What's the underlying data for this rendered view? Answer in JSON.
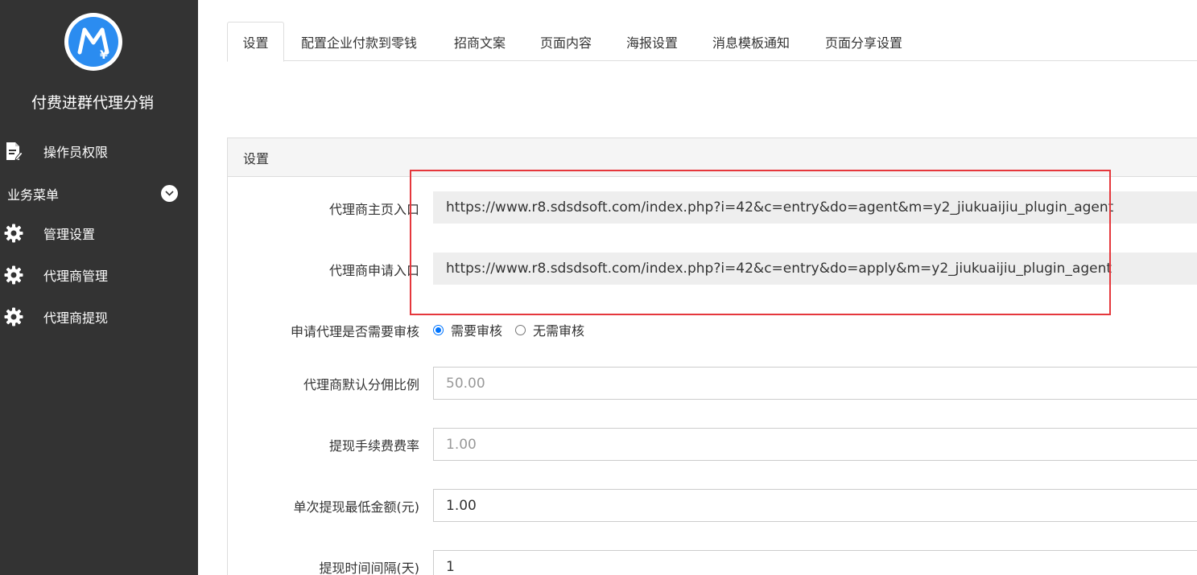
{
  "sidebar": {
    "app_title": "付费进群代理分销",
    "logo_glyph": "¥",
    "items": [
      {
        "label": "操作员权限",
        "icon": "document-edit-icon"
      },
      {
        "label": "管理设置",
        "icon": "gear-icon"
      },
      {
        "label": "代理商管理",
        "icon": "gear-icon"
      },
      {
        "label": "代理商提现",
        "icon": "gear-icon"
      }
    ],
    "group": {
      "label": "业务菜单",
      "icon": "chevron-down-icon"
    }
  },
  "tabs": [
    {
      "label": "设置",
      "active": true
    },
    {
      "label": "配置企业付款到零钱"
    },
    {
      "label": "招商文案"
    },
    {
      "label": "页面内容"
    },
    {
      "label": "海报设置"
    },
    {
      "label": "消息模板通知"
    },
    {
      "label": "页面分享设置"
    }
  ],
  "panel": {
    "heading": "设置",
    "fields": {
      "home_entry": {
        "label": "代理商主页入口",
        "value": "https://www.r8.sdsdsoft.com/index.php?i=42&c=entry&do=agent&m=y2_jiukuaijiu_plugin_agent"
      },
      "apply_entry": {
        "label": "代理商申请入口",
        "value": "https://www.r8.sdsdsoft.com/index.php?i=42&c=entry&do=apply&m=y2_jiukuaijiu_plugin_agent"
      },
      "need_review": {
        "label": "申请代理是否需要审核",
        "options": [
          "需要审核",
          "无需审核"
        ],
        "selected": "需要审核"
      },
      "default_ratio": {
        "label": "代理商默认分佣比例",
        "value": "50.00"
      },
      "fee_rate": {
        "label": "提现手续费费率",
        "value": "1.00"
      },
      "min_amount": {
        "label": "单次提现最低金额(元)",
        "value": "1.00"
      },
      "interval": {
        "label": "提现时间间隔(天)",
        "value": "1"
      }
    }
  },
  "colors": {
    "sidebar_bg": "#333333",
    "logo_blue": "#2b8cf0",
    "highlight_red": "#e5373c",
    "radio_blue": "#0075ff"
  }
}
